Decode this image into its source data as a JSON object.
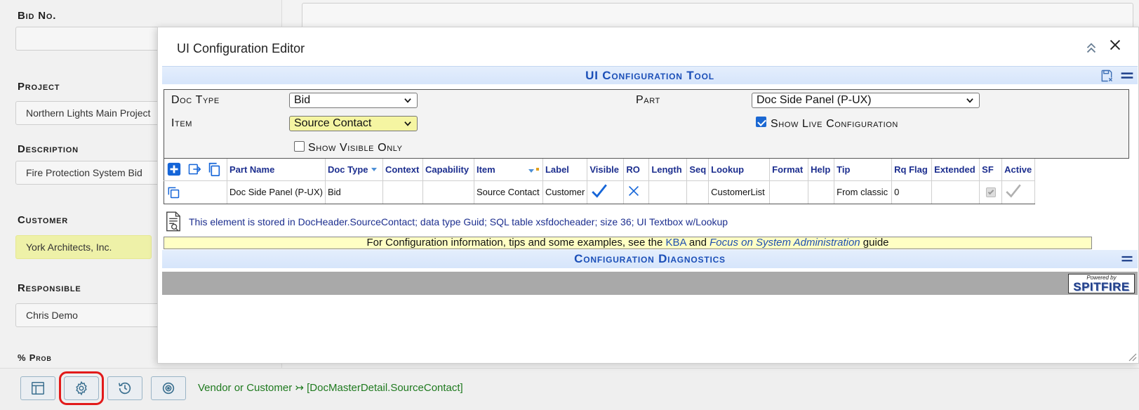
{
  "background_form": {
    "fields": [
      {
        "label": "Bid No.",
        "value": ""
      },
      {
        "label": "Project",
        "value": "Northern Lights Main Project"
      },
      {
        "label": "Description",
        "value": "Fire Protection System Bid"
      },
      {
        "label": "Customer",
        "value": "York Architects, Inc."
      },
      {
        "label": "Responsible",
        "value": "Chris Demo"
      },
      {
        "label": "% Prob",
        "value": ""
      }
    ]
  },
  "bottom_bar": {
    "status_text": "Vendor or Customer ↣ [DocMasterDetail.SourceContact]",
    "buttons": [
      "layout-icon",
      "gear-icon",
      "history-icon",
      "target-icon"
    ]
  },
  "modal": {
    "title": "UI Configuration Editor",
    "tool_title": "UI Configuration Tool",
    "doc_type_label": "Doc Type",
    "doc_type_value": "Bid",
    "item_label": "Item",
    "item_value": "Source Contact",
    "part_label": "Part",
    "part_value": "Doc Side Panel (P-UX)",
    "show_live_label": "Show Live Configuration",
    "show_live_checked": true,
    "show_visible_label": "Show Visible Only",
    "show_visible_checked": false,
    "grid": {
      "columns": [
        "Part Name",
        "Doc Type",
        "Context",
        "Capability",
        "Item",
        "Label",
        "Visible",
        "RO",
        "Length",
        "Seq",
        "Lookup",
        "Format",
        "Help",
        "Tip",
        "Rq Flag",
        "Extended",
        "SF",
        "Active"
      ],
      "row": {
        "part_name": "Doc Side Panel (P-UX)",
        "doc_type": "Bid",
        "context": "",
        "capability": "",
        "item": "Source Contact",
        "label": "Customer",
        "visible": true,
        "ro": false,
        "length": "",
        "seq": "",
        "lookup": "CustomerList",
        "format": "",
        "help": "",
        "tip": "From classic",
        "rq_flag": "0",
        "extended": "",
        "sf": true,
        "active": true
      }
    },
    "info_text": "This element is stored in DocHeader.SourceContact; data type Guid; SQL table xsfdocheader; size 36; UI Textbox w/Lookup",
    "banner": {
      "prefix": "For Configuration information, tips and some examples, see the ",
      "link1": "KBA",
      "mid": " and ",
      "link2": "Focus on System Administration",
      "suffix": " guide"
    },
    "diagnostics_title": "Configuration Diagnostics",
    "powered_by": "Powered by",
    "brand": "SPITFIRE"
  },
  "colors": {
    "header_blue": "#1b4fb8",
    "highlight_yellow": "#f5f5a2",
    "status_green": "#1f7a1f",
    "active_outline_red": "#e21a1a"
  }
}
